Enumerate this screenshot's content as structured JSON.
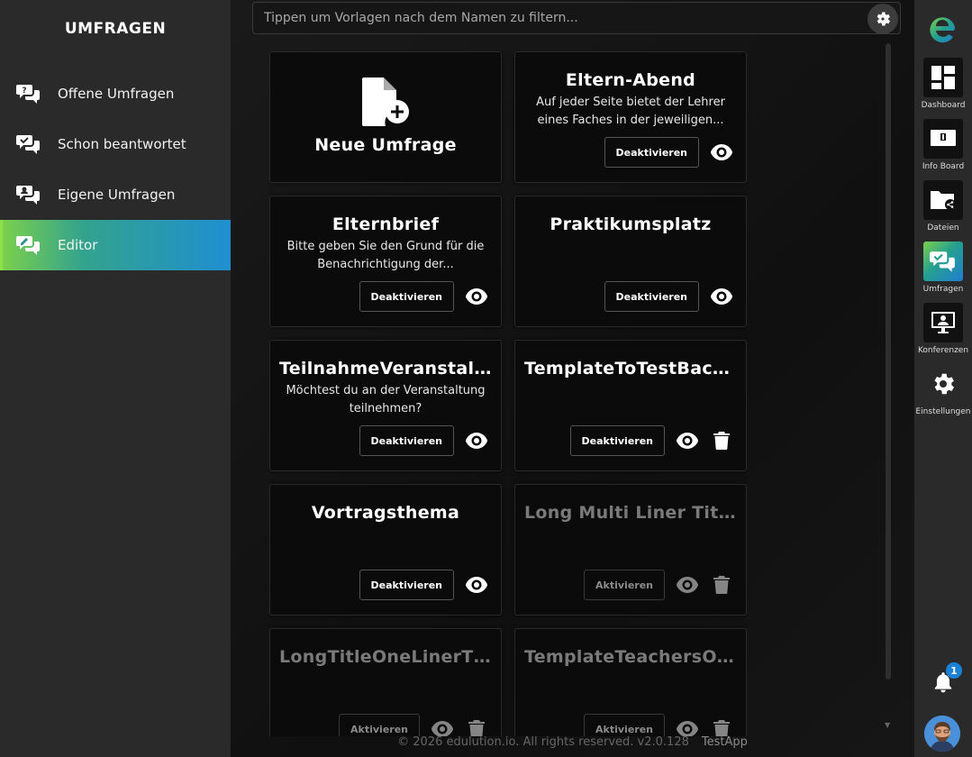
{
  "sidebar": {
    "title": "UMFRAGEN",
    "items": [
      {
        "label": "Offene Umfragen",
        "icon": "question-chat-icon"
      },
      {
        "label": "Schon beantwortet",
        "icon": "check-chat-icon"
      },
      {
        "label": "Eigene Umfragen",
        "icon": "user-chat-icon"
      },
      {
        "label": "Editor",
        "icon": "edit-chat-icon",
        "active": true
      }
    ]
  },
  "filter": {
    "placeholder": "Tippen um Vorlagen nach dem Namen zu filtern..."
  },
  "new_card": {
    "label": "Neue Umfrage"
  },
  "cards": [
    {
      "title": "Eltern-Abend",
      "desc": "Auf jeder Seite bietet der Lehrer eines Faches in der jeweiligen...",
      "action": "Deaktivieren",
      "deletable": false,
      "active": true
    },
    {
      "title": "Elternbrief",
      "desc": "Bitte geben Sie den Grund für die Benachrichtigung der...",
      "action": "Deaktivieren",
      "deletable": false,
      "active": true
    },
    {
      "title": "Praktikumsplatz",
      "desc": "",
      "action": "Deaktivieren",
      "deletable": false,
      "active": true
    },
    {
      "title": "TeilnahmeVeranstalt...",
      "desc": "Möchtest du an der Veranstaltung teilnehmen?",
      "action": "Deaktivieren",
      "deletable": false,
      "active": true
    },
    {
      "title": "TemplateToTestBack...",
      "desc": "",
      "action": "Deaktivieren",
      "deletable": true,
      "active": true
    },
    {
      "title": "Vortragsthema",
      "desc": "",
      "action": "Deaktivieren",
      "deletable": false,
      "active": true
    },
    {
      "title": "Long Multi Liner Title...",
      "desc": "",
      "action": "Aktivieren",
      "deletable": true,
      "active": false
    },
    {
      "title": "LongTitleOneLinerTh...",
      "desc": "",
      "action": "Aktivieren",
      "deletable": true,
      "active": false
    },
    {
      "title": "TemplateTeachersOnly",
      "desc": "",
      "action": "Aktivieren",
      "deletable": true,
      "active": false
    }
  ],
  "footer": {
    "copyright": "© 2026 edulution.io. All rights reserved. v2.0.128",
    "app": "TestApp"
  },
  "rail": {
    "items": [
      {
        "label": "Dashboard",
        "icon": "dashboard-icon"
      },
      {
        "label": "Info Board",
        "icon": "info-board-icon"
      },
      {
        "label": "Dateien",
        "icon": "folder-share-icon"
      },
      {
        "label": "Umfragen",
        "icon": "survey-chat-icon",
        "active": true
      },
      {
        "label": "Konferenzen",
        "icon": "conference-icon"
      },
      {
        "label": "Einstellungen",
        "icon": "gear-icon"
      }
    ],
    "notifications": "1"
  },
  "colors": {
    "accent_green": "#7bd04c",
    "accent_blue": "#1f8fd1",
    "badge": "#1a82d6"
  }
}
